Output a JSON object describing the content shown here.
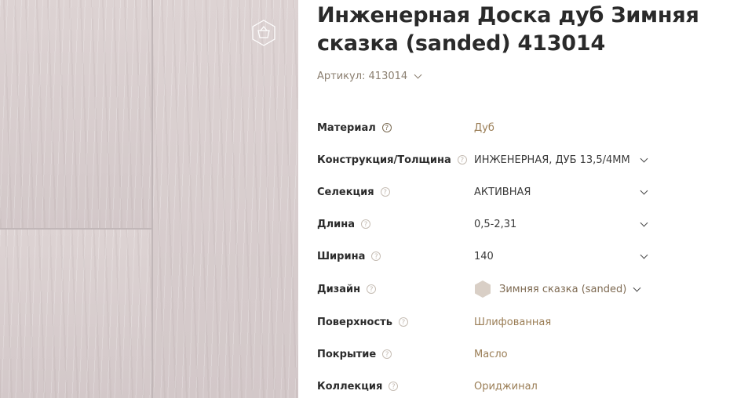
{
  "product": {
    "title": "Инженерная Доска дуб Зимняя сказка (sanded) 413014",
    "sku_label": "Артикул: 413014"
  },
  "gallery": {
    "action_icon": "basket-icon"
  },
  "help_icon_glyph": "?",
  "specs": [
    {
      "label": "Материал",
      "value": "Дуб",
      "kind": "link"
    },
    {
      "label": "Конструкция/Толщина",
      "value": "ИНЖЕНЕРНАЯ, ДУБ 13,5/4ММ",
      "kind": "dropdown"
    },
    {
      "label": "Селекция",
      "value": "АКТИВНАЯ",
      "kind": "dropdown"
    },
    {
      "label": "Длина",
      "value": "0,5-2,31",
      "kind": "dropdown"
    },
    {
      "label": "Ширина",
      "value": "140",
      "kind": "dropdown"
    },
    {
      "label": "Дизайн",
      "value": "Зимняя сказка (sanded)",
      "kind": "design"
    },
    {
      "label": "Поверхность",
      "value": "Шлифованная",
      "kind": "link"
    },
    {
      "label": "Покрытие",
      "value": "Масло",
      "kind": "link"
    },
    {
      "label": "Коллекция",
      "value": "Ориджинал",
      "kind": "link"
    }
  ],
  "colors": {
    "accent_text": "#9a7d55",
    "swatch": "#d9cfc6"
  }
}
